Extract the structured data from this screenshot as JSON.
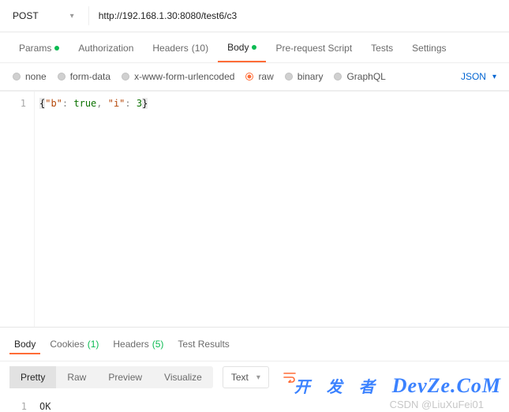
{
  "request": {
    "method": "POST",
    "url": "http://192.168.1.30:8080/test6/c3"
  },
  "tabs": {
    "params": "Params",
    "authorization": "Authorization",
    "headers_label": "Headers",
    "headers_count": "(10)",
    "body": "Body",
    "prerequest": "Pre-request Script",
    "tests": "Tests",
    "settings": "Settings"
  },
  "body_type": {
    "none": "none",
    "formdata": "form-data",
    "xwww": "x-www-form-urlencoded",
    "raw": "raw",
    "binary": "binary",
    "graphql": "GraphQL",
    "format": "JSON"
  },
  "editor": {
    "line": "1",
    "open": "{",
    "k1": "\"b\"",
    "c1": ": ",
    "v1": "true",
    "sep": ", ",
    "k2": "\"i\"",
    "c2": ": ",
    "v2": "3",
    "close": "}"
  },
  "response": {
    "tabs": {
      "body": "Body",
      "cookies_label": "Cookies",
      "cookies_count": "(1)",
      "headers_label": "Headers",
      "headers_count": "(5)",
      "tests": "Test Results"
    },
    "views": {
      "pretty": "Pretty",
      "raw": "Raw",
      "preview": "Preview",
      "visualize": "Visualize"
    },
    "format": "Text",
    "line": "1",
    "text": "OK"
  },
  "watermark": {
    "cn": "开 发 者",
    "en": "DevZe.CoM",
    "csdn": "CSDN @LiuXuFei01"
  }
}
